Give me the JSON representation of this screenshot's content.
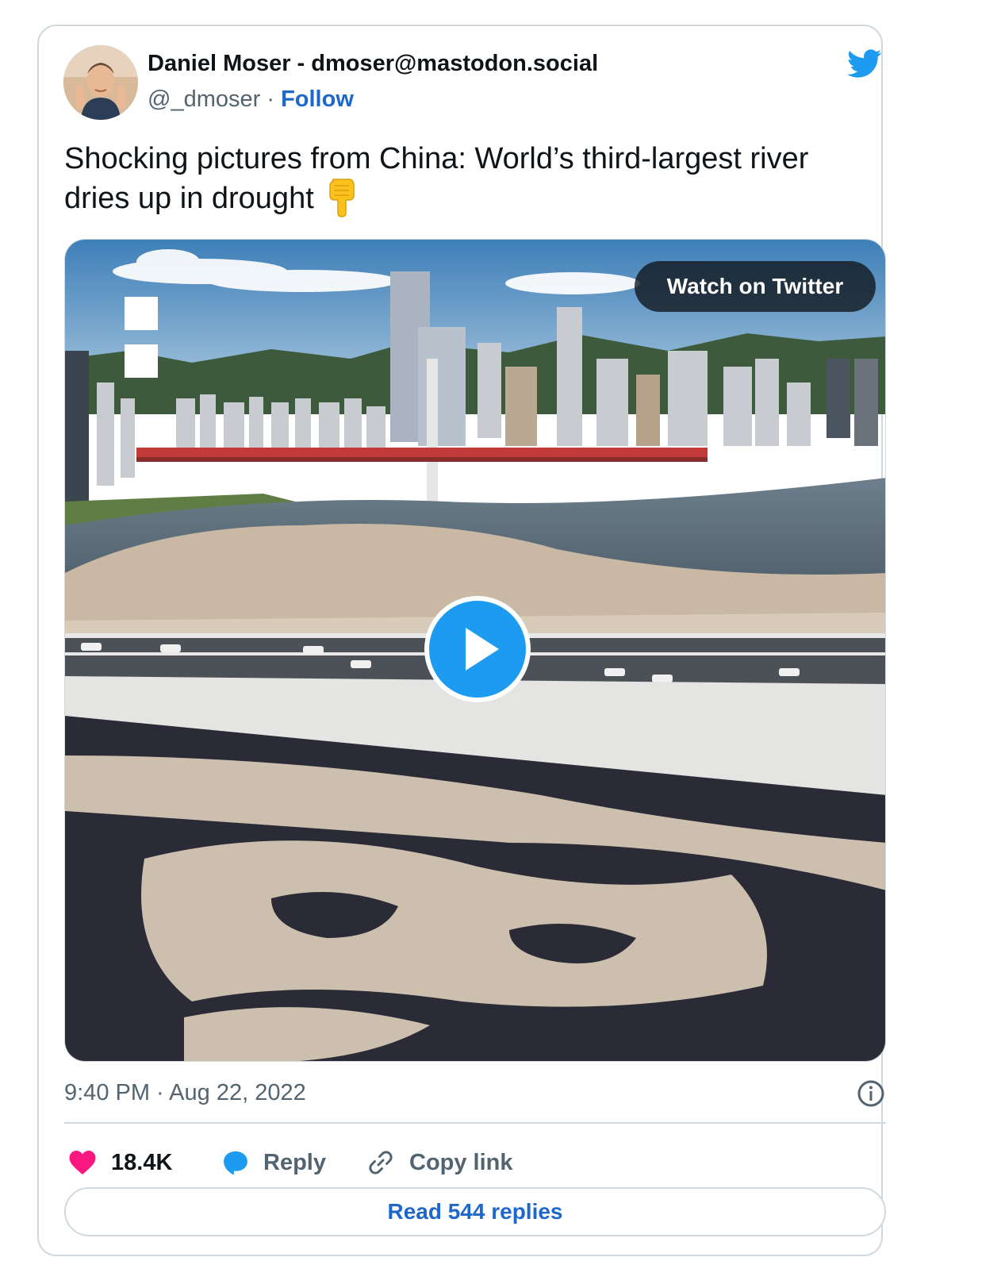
{
  "author": {
    "name": "Daniel Moser - dmoser@mastodon.social",
    "handle": "@_dmoser",
    "separator": " · ",
    "follow_label": "Follow"
  },
  "tweet": {
    "text": "Shocking pictures from China: World’s third-largest river dries up in drought",
    "emoji": "backhand-index-pointing-down"
  },
  "media": {
    "watch_label": "Watch on Twitter",
    "play_icon": "play-icon"
  },
  "meta": {
    "timestamp": "9:40 PM · Aug 22, 2022",
    "info_icon": "info-icon"
  },
  "actions": {
    "like_count": "18.4K",
    "reply_label": "Reply",
    "copy_label": "Copy link"
  },
  "read_replies_label": "Read 544 replies",
  "colors": {
    "twitter_blue": "#1d9bf0",
    "link_blue": "#1d68c9",
    "heart_pink": "#f91880",
    "muted_text": "#536471",
    "border": "#cfd9de"
  }
}
